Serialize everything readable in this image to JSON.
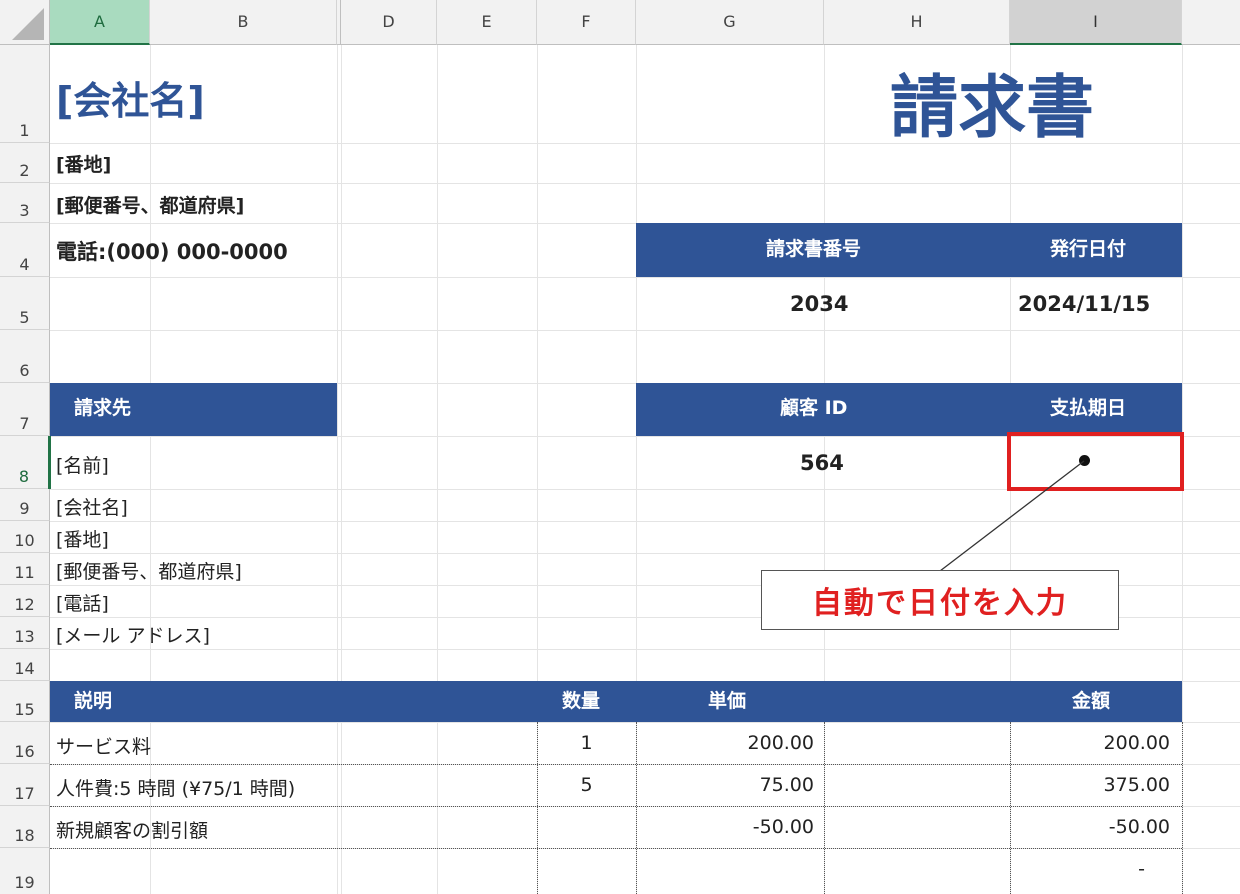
{
  "grid": {
    "columns": [
      "A",
      "B",
      "",
      "D",
      "E",
      "F",
      "G",
      "H",
      "I"
    ],
    "rows": [
      "1",
      "2",
      "3",
      "4",
      "5",
      "6",
      "7",
      "8",
      "9",
      "10",
      "11",
      "12",
      "13",
      "14",
      "15",
      "16",
      "17",
      "18",
      "19"
    ]
  },
  "company": {
    "name": "[会社名]",
    "street": "[番地]",
    "zip_pref": "[郵便番号、都道府県]",
    "phone": "電話:(000) 000-0000"
  },
  "title": "請求書",
  "invoice_header": {
    "number_label": "請求書番号",
    "date_label": "発行日付"
  },
  "invoice_values": {
    "number": "2034",
    "date": "2024/11/15"
  },
  "bill_to": {
    "label": "請求先",
    "lines": [
      "[名前]",
      "[会社名]",
      "[番地]",
      "[郵便番号、都道府県]",
      "[電話]",
      "[メール アドレス]"
    ]
  },
  "customer_header": {
    "id_label": "顧客 ID",
    "due_label": "支払期日"
  },
  "customer_values": {
    "id": "564",
    "due": ""
  },
  "callout": {
    "text": "自動で日付を入力"
  },
  "items_header": {
    "desc": "説明",
    "qty": "数量",
    "unit": "単価",
    "amount": "金額"
  },
  "items": [
    {
      "desc": "サービス料",
      "qty": "1",
      "unit": "200.00",
      "amount": "200.00"
    },
    {
      "desc": "人件費:5 時間 (¥75/1 時間)",
      "qty": "5",
      "unit": "75.00",
      "amount": "375.00"
    },
    {
      "desc": "新規顧客の割引額",
      "qty": "",
      "unit": "-50.00",
      "amount": "-50.00"
    },
    {
      "desc": "",
      "qty": "",
      "unit": "",
      "amount": "-"
    }
  ],
  "colors": {
    "header_band": "#2f5496",
    "title": "#2f5496",
    "callout_red": "#e02020",
    "selection_green": "#217346"
  }
}
